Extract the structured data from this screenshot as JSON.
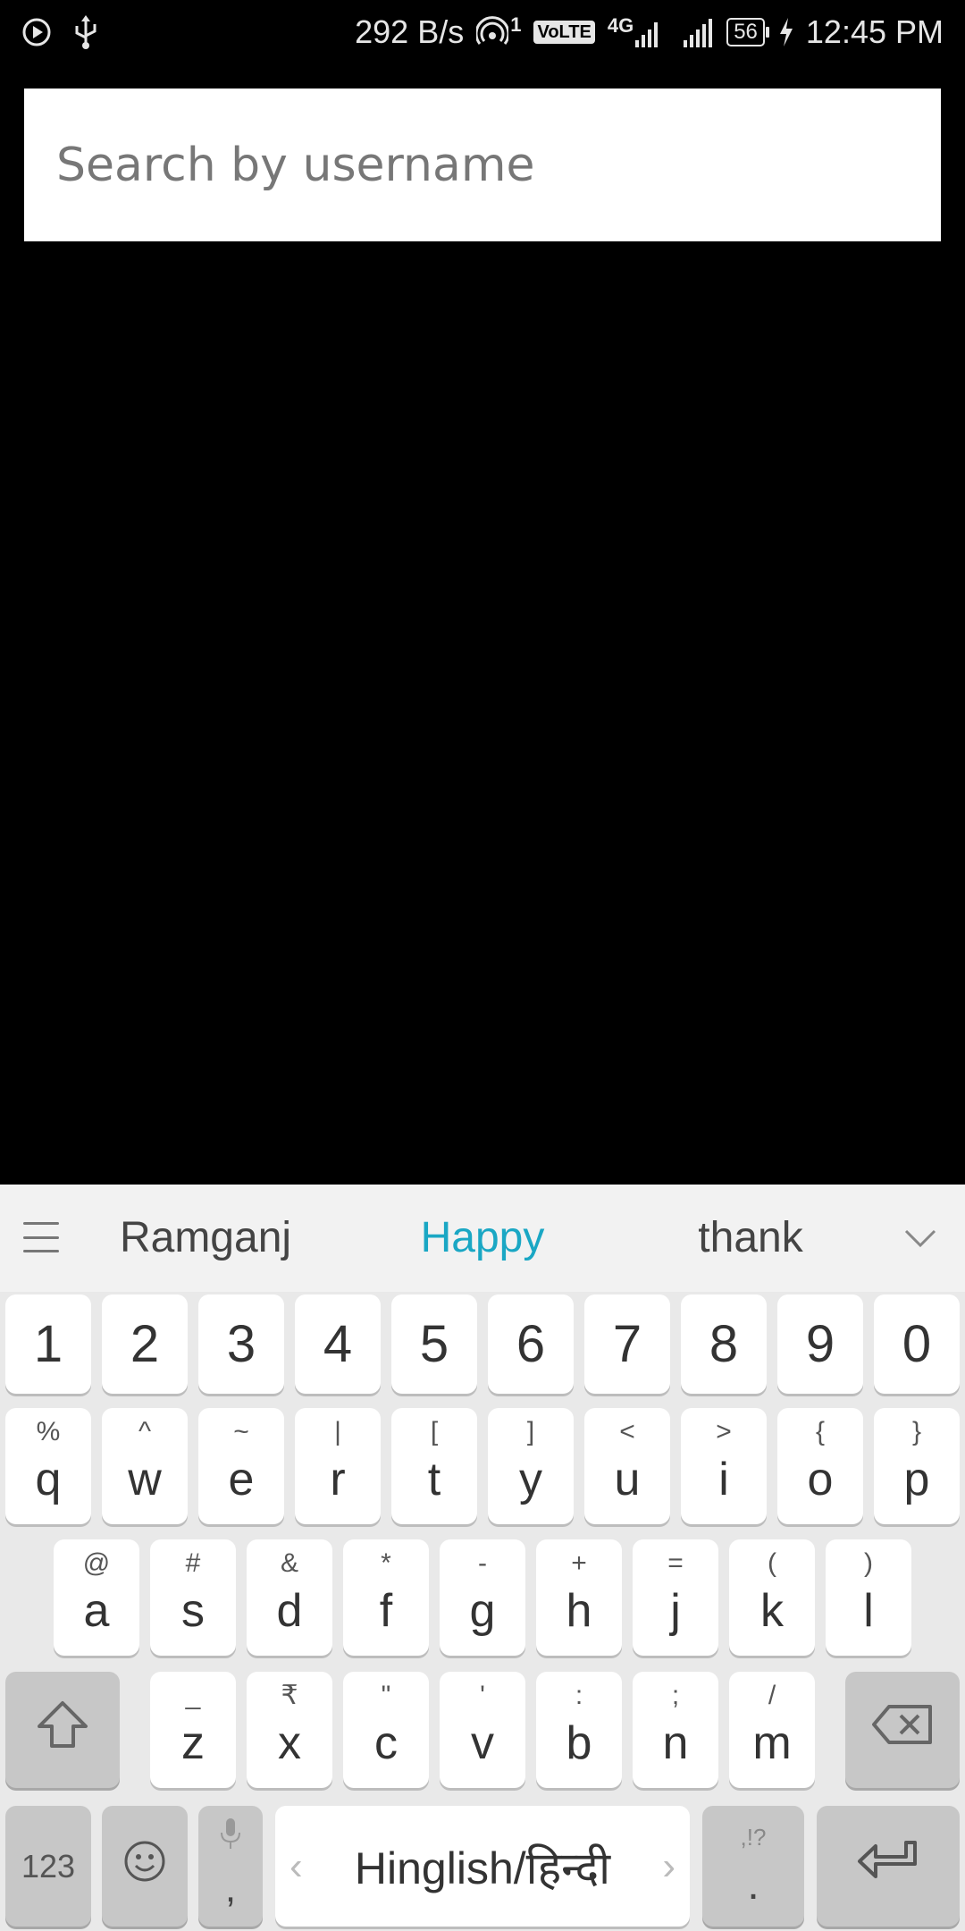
{
  "status_bar": {
    "network_speed": "292 B/s",
    "hotspot_count": "1",
    "volte": "VoLTE",
    "network_type": "4G",
    "battery": "56",
    "time": "12:45 PM"
  },
  "search": {
    "placeholder": "Search by username"
  },
  "keyboard": {
    "suggestions": [
      "Ramganj",
      "Happy",
      "thank"
    ],
    "number_row": [
      "1",
      "2",
      "3",
      "4",
      "5",
      "6",
      "7",
      "8",
      "9",
      "0"
    ],
    "row1": [
      {
        "key": "q",
        "hint": "%"
      },
      {
        "key": "w",
        "hint": "^"
      },
      {
        "key": "e",
        "hint": "~"
      },
      {
        "key": "r",
        "hint": "|"
      },
      {
        "key": "t",
        "hint": "["
      },
      {
        "key": "y",
        "hint": "]"
      },
      {
        "key": "u",
        "hint": "<"
      },
      {
        "key": "i",
        "hint": ">"
      },
      {
        "key": "o",
        "hint": "{"
      },
      {
        "key": "p",
        "hint": "}"
      }
    ],
    "row2": [
      {
        "key": "a",
        "hint": "@"
      },
      {
        "key": "s",
        "hint": "#"
      },
      {
        "key": "d",
        "hint": "&"
      },
      {
        "key": "f",
        "hint": "*"
      },
      {
        "key": "g",
        "hint": "-"
      },
      {
        "key": "h",
        "hint": "+"
      },
      {
        "key": "j",
        "hint": "="
      },
      {
        "key": "k",
        "hint": "("
      },
      {
        "key": "l",
        "hint": ")"
      }
    ],
    "row3": [
      {
        "key": "z",
        "hint": "_"
      },
      {
        "key": "x",
        "hint": "₹"
      },
      {
        "key": "c",
        "hint": "\""
      },
      {
        "key": "v",
        "hint": "'"
      },
      {
        "key": "b",
        "hint": ":"
      },
      {
        "key": "n",
        "hint": ";"
      },
      {
        "key": "m",
        "hint": "/"
      }
    ],
    "symbols_label": "123",
    "comma_label": ",",
    "space_label": "Hinglish/हिन्दी",
    "period_label": ".",
    "period_hint": ",!?"
  }
}
